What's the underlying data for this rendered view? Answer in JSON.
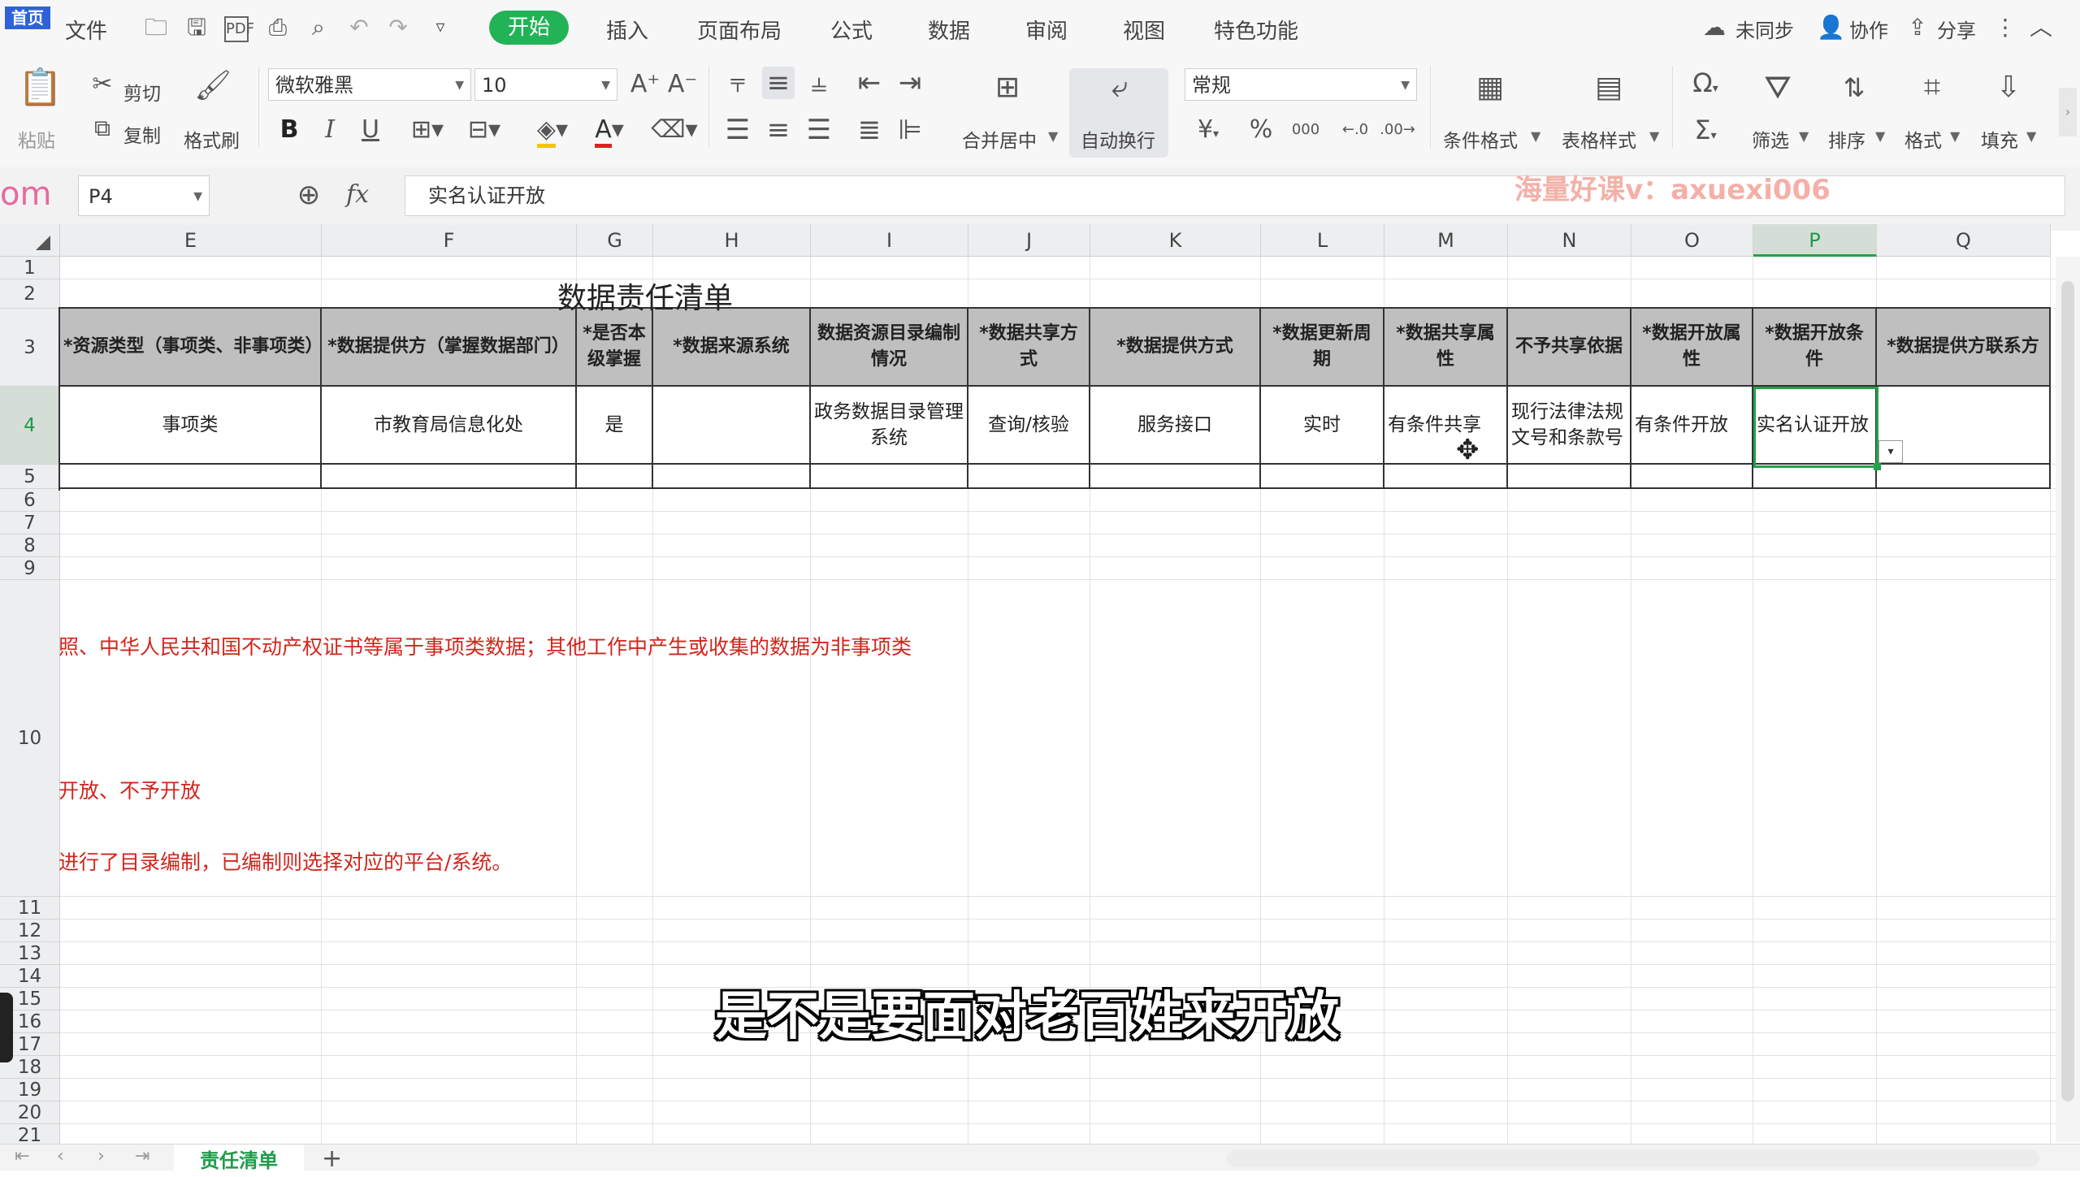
{
  "menu": {
    "logo": "首页",
    "file": "文件",
    "tabs": [
      "开始",
      "插入",
      "页面布局",
      "公式",
      "数据",
      "审阅",
      "视图",
      "特色功能"
    ],
    "sync": "未同步",
    "collab": "协作",
    "share": "分享"
  },
  "ribbon": {
    "paste": "粘贴",
    "cut": "剪切",
    "copy": "复制",
    "format_painter": "格式刷",
    "font_name": "微软雅黑",
    "font_size": "10",
    "merge_center": "合并居中",
    "wrap_text": "自动换行",
    "number_format": "常规",
    "cond_format": "条件格式",
    "table_style": "表格样式",
    "filter": "筛选",
    "sort": "排序",
    "format": "格式",
    "fill": "填充",
    "bold": "B",
    "italic": "I",
    "underline": "U",
    "currency": "¥",
    "percent": "%",
    "thousands": "000"
  },
  "formula_bar": {
    "name_box": "P4",
    "fx": "fx",
    "content": "实名认证开放",
    "left_fragment": "om"
  },
  "watermark": "海量好课v：axuexi006",
  "columns": [
    "E",
    "F",
    "G",
    "H",
    "I",
    "J",
    "K",
    "L",
    "M",
    "N",
    "O",
    "P",
    "Q"
  ],
  "rows": [
    "1",
    "2",
    "3",
    "4",
    "5",
    "6",
    "7",
    "8",
    "9",
    "10",
    "11",
    "12",
    "13",
    "14",
    "15",
    "16",
    "17",
    "18",
    "19",
    "20",
    "21"
  ],
  "sheet_title": "数据责任清单",
  "header_row": [
    "*资源类型（事项类、非事项类）",
    "*数据提供方（掌握数据部门）",
    "*是否本级掌握",
    "*数据来源系统",
    "数据资源目录编制情况",
    "*数据共享方式",
    "*数据提供方式",
    "*数据更新周期",
    "*数据共享属性",
    "不予共享依据",
    "*数据开放属性",
    "*数据开放条件",
    "*数据提供方联系方"
  ],
  "data_row": [
    "事项类",
    "市教育局信息化处",
    "是",
    "",
    "政务数据目录管理系统",
    "查询/核验",
    "服务接口",
    "实时",
    "有条件共享",
    "现行法律法规文号和条款号",
    "有条件开放",
    "实名认证开放",
    ""
  ],
  "notes": [
    "照、中华人民共和国不动产权证书等属于事项类数据；其他工作中产生或收集的数据为非事项类",
    "开放、不予开放",
    "进行了目录编制，已编制则选择对应的平台/系统。"
  ],
  "subtitle": "是不是要面对老百姓来开放",
  "sheet_tab": "责任清单",
  "add_sheet": "+",
  "colors": {
    "accent_green": "#22b357",
    "header_fill": "#bfbfbf",
    "note_red": "#d0261c",
    "watermark": "#f4b0a8"
  }
}
